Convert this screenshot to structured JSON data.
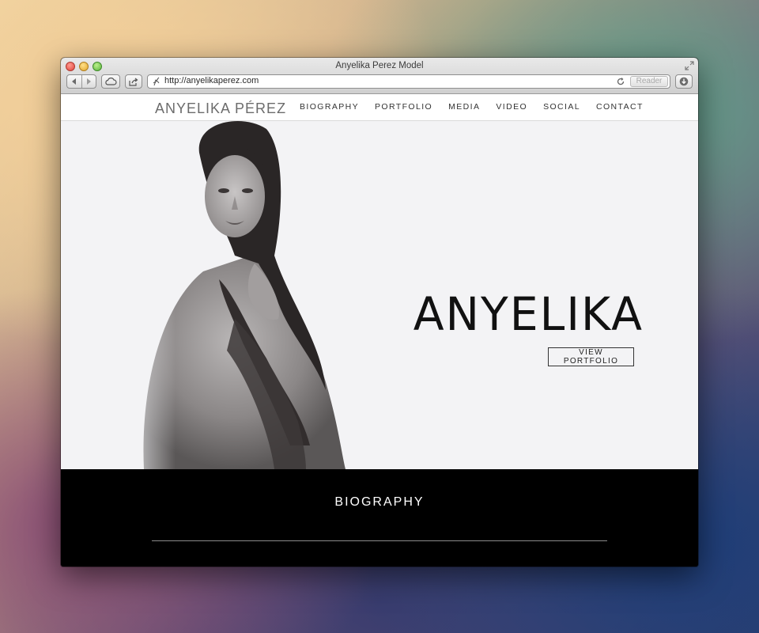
{
  "window": {
    "title": "Anyelika Perez Model"
  },
  "toolbar": {
    "url": "http://anyelikaperez.com",
    "reader_label": "Reader",
    "icons": [
      "back-icon",
      "forward-icon",
      "icloud-tabs-icon",
      "share-icon",
      "site-icon",
      "reload-icon",
      "downloads-icon",
      "fullscreen-icon"
    ]
  },
  "site": {
    "logo": "ANYELIKA PÉREZ",
    "menu": [
      "BIOGRAPHY",
      "PORTFOLIO",
      "MEDIA",
      "VIDEO",
      "SOCIAL",
      "CONTACT"
    ],
    "hero": {
      "title": "ANYELIKA",
      "button_label": "VIEW PORTFOLIO"
    },
    "section": {
      "title": "BIOGRAPHY"
    }
  },
  "colors": {
    "hero_bg": "#f3f3f5",
    "section_bg": "#000000",
    "nav_bg": "#ffffff"
  }
}
